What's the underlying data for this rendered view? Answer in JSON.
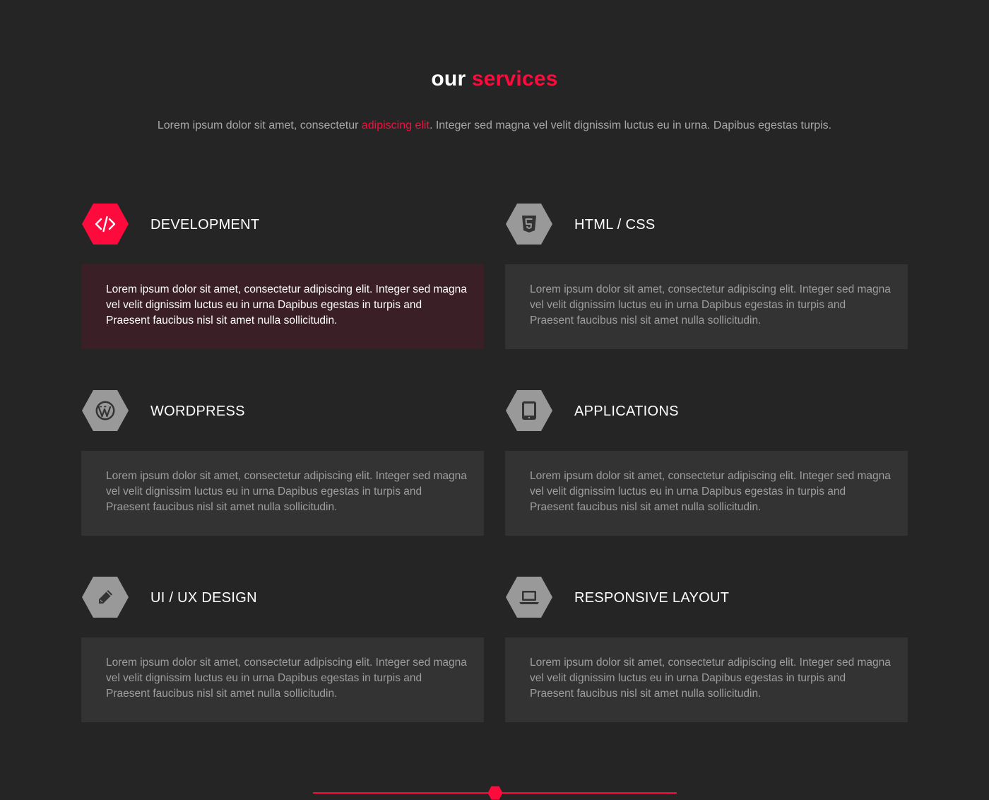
{
  "header": {
    "title_prefix": "our",
    "title_accent": "services",
    "intro_before": "Lorem ipsum dolor sit amet, consectetur ",
    "intro_link": "adipiscing elit",
    "intro_after": ". Integer sed magna vel velit dignissim luctus eu in urna. Dapibus egestas turpis."
  },
  "colors": {
    "background": "#252525",
    "accent": "#ff0a3c",
    "card": "#333333",
    "card_active": "#3a2026",
    "hex_inactive": "#999999"
  },
  "services": [
    {
      "title": "DEVELOPMENT",
      "icon": "code-icon",
      "active": true,
      "text": "Lorem ipsum dolor sit amet, consectetur adipiscing elit. Integer sed magna vel velit dignissim luctus eu in urna Dapibus egestas in turpis and Praesent faucibus nisl sit amet nulla sollicitudin."
    },
    {
      "title": "HTML / CSS",
      "icon": "html5-icon",
      "active": false,
      "text": "Lorem ipsum dolor sit amet, consectetur adipiscing elit. Integer sed magna vel velit dignissim luctus eu in urna Dapibus egestas in turpis and Praesent faucibus nisl sit amet nulla sollicitudin."
    },
    {
      "title": "WORDPRESS",
      "icon": "wordpress-icon",
      "active": false,
      "text": "Lorem ipsum dolor sit amet, consectetur adipiscing elit. Integer sed magna vel velit dignissim luctus eu in urna Dapibus egestas in turpis and Praesent faucibus nisl sit amet nulla sollicitudin."
    },
    {
      "title": "APPLICATIONS",
      "icon": "tablet-icon",
      "active": false,
      "text": "Lorem ipsum dolor sit amet, consectetur adipiscing elit. Integer sed magna vel velit dignissim luctus eu in urna Dapibus egestas in turpis and Praesent faucibus nisl sit amet nulla sollicitudin."
    },
    {
      "title": "UI / UX DESIGN",
      "icon": "pencil-icon",
      "active": false,
      "text": "Lorem ipsum dolor sit amet, consectetur adipiscing elit. Integer sed magna vel velit dignissim luctus eu in urna Dapibus egestas in turpis and Praesent faucibus nisl sit amet nulla sollicitudin."
    },
    {
      "title": "RESPONSIVE LAYOUT",
      "icon": "laptop-icon",
      "active": false,
      "text": "Lorem ipsum dolor sit amet, consectetur adipiscing elit. Integer sed magna vel velit dignissim luctus eu in urna Dapibus egestas in turpis and Praesent faucibus nisl sit amet nulla sollicitudin."
    }
  ]
}
